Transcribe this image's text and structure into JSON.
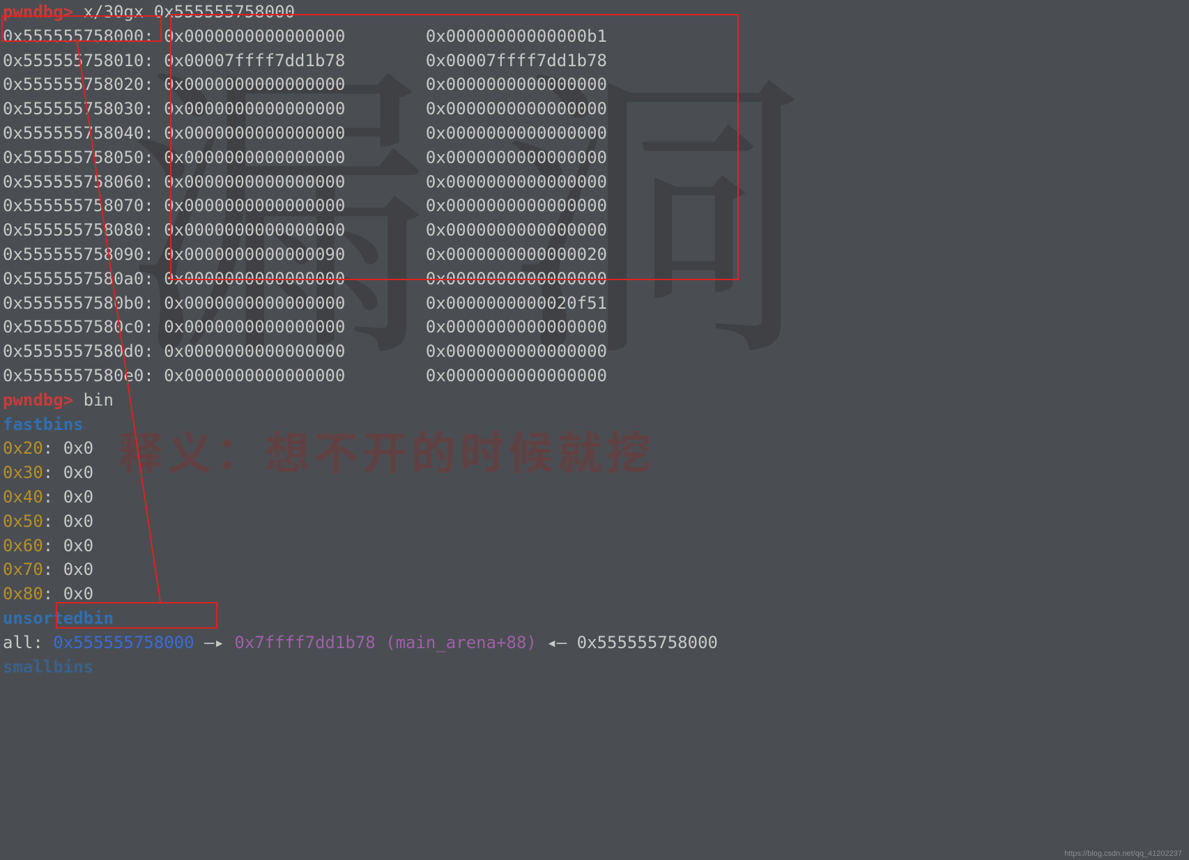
{
  "prompt": "pwndbg>",
  "cmd1": "x/30gx 0x555555758000",
  "memory_rows": [
    {
      "addr": "0x555555758000",
      "col1": "0x0000000000000000",
      "col2": "0x00000000000000b1"
    },
    {
      "addr": "0x555555758010",
      "col1": "0x00007ffff7dd1b78",
      "col2": "0x00007ffff7dd1b78"
    },
    {
      "addr": "0x555555758020",
      "col1": "0x0000000000000000",
      "col2": "0x0000000000000000"
    },
    {
      "addr": "0x555555758030",
      "col1": "0x0000000000000000",
      "col2": "0x0000000000000000"
    },
    {
      "addr": "0x555555758040",
      "col1": "0x0000000000000000",
      "col2": "0x0000000000000000"
    },
    {
      "addr": "0x555555758050",
      "col1": "0x0000000000000000",
      "col2": "0x0000000000000000"
    },
    {
      "addr": "0x555555758060",
      "col1": "0x0000000000000000",
      "col2": "0x0000000000000000"
    },
    {
      "addr": "0x555555758070",
      "col1": "0x0000000000000000",
      "col2": "0x0000000000000000"
    },
    {
      "addr": "0x555555758080",
      "col1": "0x0000000000000000",
      "col2": "0x0000000000000000"
    },
    {
      "addr": "0x555555758090",
      "col1": "0x0000000000000090",
      "col2": "0x0000000000000020"
    },
    {
      "addr": "0x5555557580a0",
      "col1": "0x0000000000000000",
      "col2": "0x0000000000000000"
    },
    {
      "addr": "0x5555557580b0",
      "col1": "0x0000000000000000",
      "col2": "0x0000000000020f51"
    },
    {
      "addr": "0x5555557580c0",
      "col1": "0x0000000000000000",
      "col2": "0x0000000000000000"
    },
    {
      "addr": "0x5555557580d0",
      "col1": "0x0000000000000000",
      "col2": "0x0000000000000000"
    },
    {
      "addr": "0x5555557580e0",
      "col1": "0x0000000000000000",
      "col2": "0x0000000000000000"
    }
  ],
  "cmd2": "bin",
  "fastbins_label": "fastbins",
  "fastbins": [
    {
      "size": "0x20",
      "val": "0x0"
    },
    {
      "size": "0x30",
      "val": "0x0"
    },
    {
      "size": "0x40",
      "val": "0x0"
    },
    {
      "size": "0x50",
      "val": "0x0"
    },
    {
      "size": "0x60",
      "val": "0x0"
    },
    {
      "size": "0x70",
      "val": "0x0"
    },
    {
      "size": "0x80",
      "val": "0x0"
    }
  ],
  "unsortedbin_label": "unsortedbin",
  "unsortedbin": {
    "all_label": "all",
    "link": "0x555555758000",
    "arrow_right": "—▸",
    "main_arena": "0x7ffff7dd1b78 (main_arena+88)",
    "arrow_left": "◂—",
    "back": "0x555555758000"
  },
  "smallbins_label": "smallbins",
  "bg": {
    "h1": "漏",
    "h2": "洞",
    "text": "释义：想不开的时候就挖"
  },
  "watermark": "https://blog.csdn.net/qq_41202237"
}
